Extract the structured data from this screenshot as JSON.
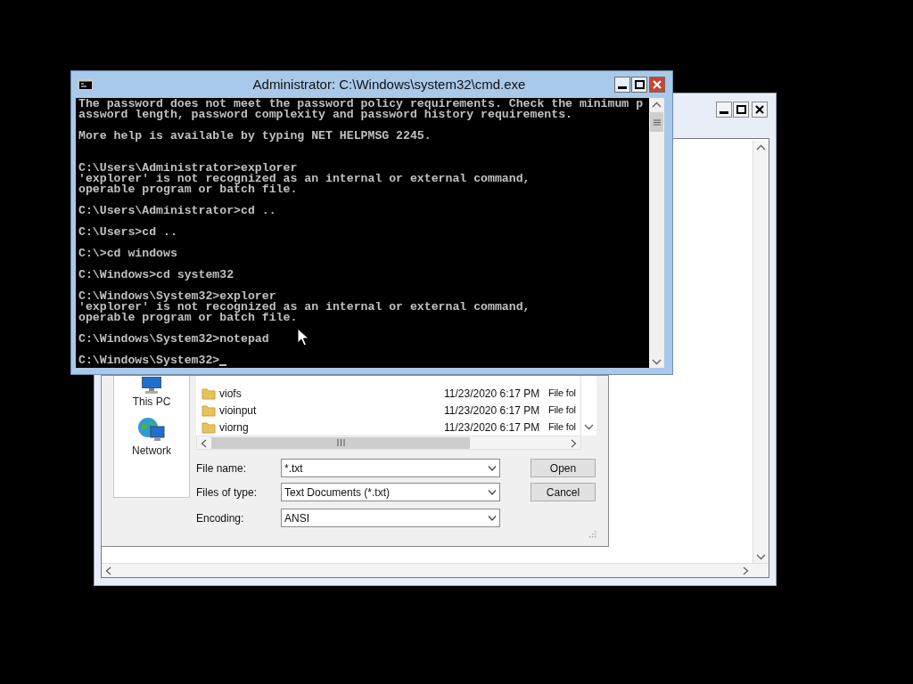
{
  "open_dialog": {
    "nav_items": [
      {
        "label": "This PC",
        "kind": "computer"
      },
      {
        "label": "Network",
        "kind": "network"
      }
    ],
    "files": [
      {
        "name": "viofs",
        "date": "11/23/2020 6:17 PM",
        "type": "File fol"
      },
      {
        "name": "vioinput",
        "date": "11/23/2020 6:17 PM",
        "type": "File fol"
      },
      {
        "name": "viorng",
        "date": "11/23/2020 6:17 PM",
        "type": "File fol"
      }
    ],
    "fields": [
      {
        "label": "File name:",
        "value": "*.txt",
        "button": "Open"
      },
      {
        "label": "Files of type:",
        "value": "Text Documents (*.txt)",
        "button": "Cancel"
      },
      {
        "label": "Encoding:",
        "value": "ANSI"
      }
    ]
  },
  "cmd_window": {
    "title": "Administrator: C:\\Windows\\system32\\cmd.exe",
    "output": "The password does not meet the password policy requirements. Check the minimum p\nassword length, password complexity and password history requirements.\n\nMore help is available by typing NET HELPMSG 2245.\n\n\nC:\\Users\\Administrator>explorer\n'explorer' is not recognized as an internal or external command,\noperable program or batch file.\n\nC:\\Users\\Administrator>cd ..\n\nC:\\Users>cd ..\n\nC:\\>cd windows\n\nC:\\Windows>cd system32\n\nC:\\Windows\\System32>explorer\n'explorer' is not recognized as an internal or external command,\noperable program or batch file.\n\nC:\\Windows\\System32>notepad\n\nC:\\Windows\\System32>",
    "cursor_visible": true
  }
}
